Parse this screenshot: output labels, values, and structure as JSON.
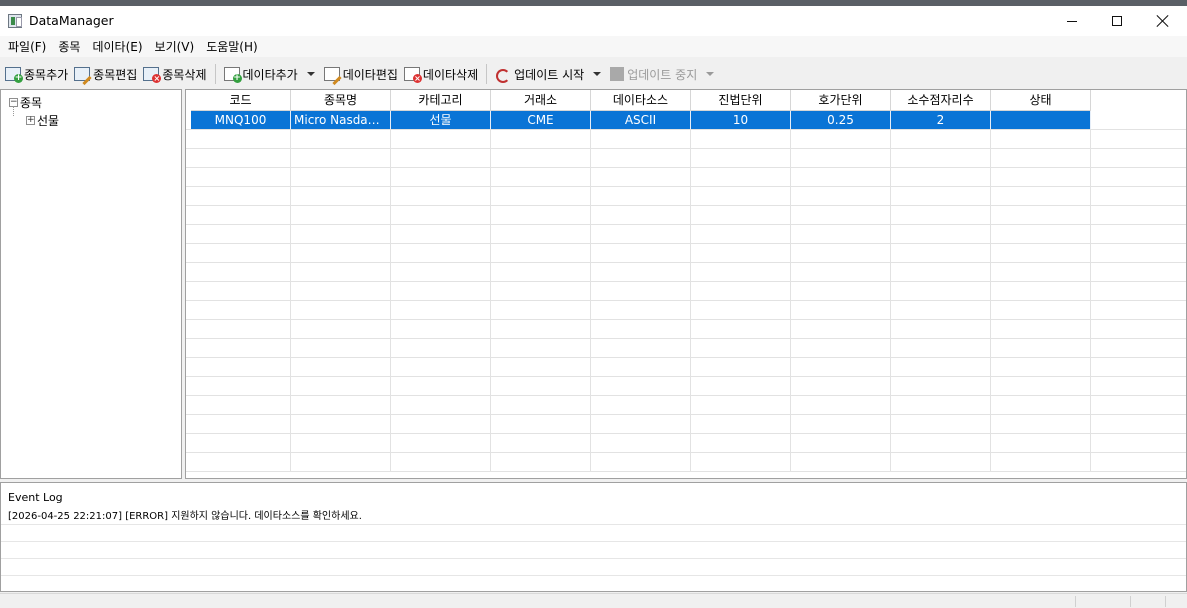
{
  "window": {
    "title": "DataManager"
  },
  "menu": [
    "파일(F)",
    "종목",
    "데이타(E)",
    "보기(V)",
    "도움말(H)"
  ],
  "toolbar": {
    "add_symbol": "종목추가",
    "edit_symbol": "종목편집",
    "delete_symbol": "종목삭제",
    "add_data": "데이타추가",
    "edit_data": "데이타편집",
    "delete_data": "데이타삭제",
    "start_update": "업데이트 시작",
    "stop_update": "업데이트 중지"
  },
  "tree": {
    "root": "종목",
    "child": "선물"
  },
  "grid": {
    "columns": [
      "코드",
      "종목명",
      "카테고리",
      "거래소",
      "데이타소스",
      "진법단위",
      "호가단위",
      "소수점자리수",
      "상태"
    ],
    "rows": [
      [
        "MNQ100",
        "Micro Nasdaq ...",
        "선물",
        "CME",
        "ASCII",
        "10",
        "0.25",
        "2",
        ""
      ]
    ]
  },
  "event_log": {
    "title": "Event Log",
    "lines": [
      "[2026-04-25 22:21:07] [ERROR] 지원하지 않습니다. 데이타소스를 확인하세요."
    ]
  }
}
